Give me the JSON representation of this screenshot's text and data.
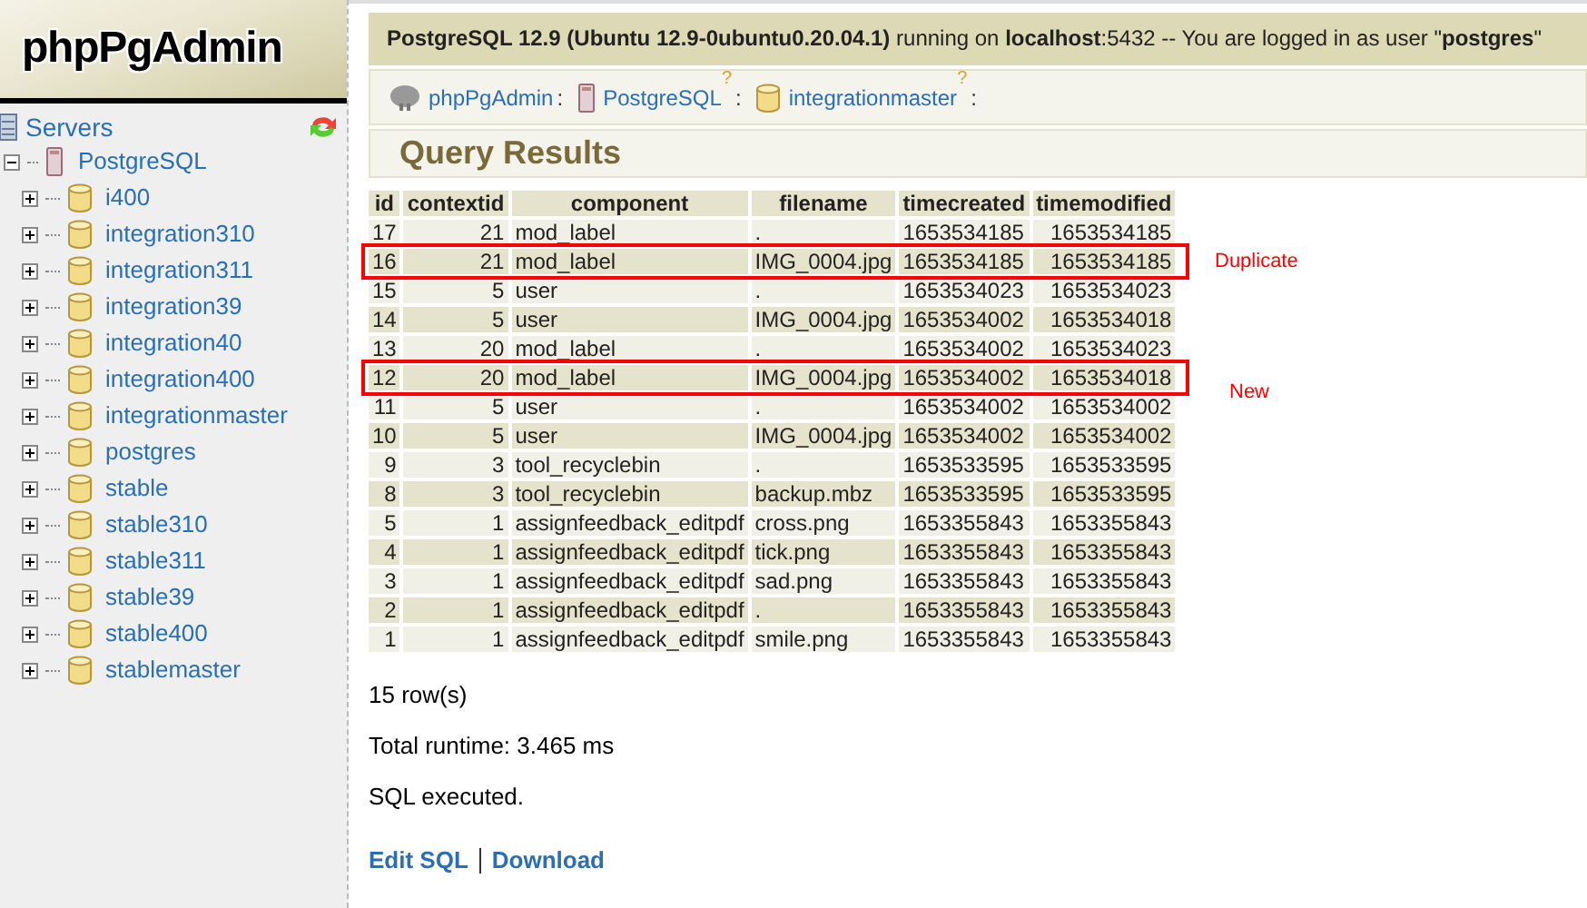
{
  "logo": "phpPgAdmin",
  "sidebar": {
    "root": "Servers",
    "server": {
      "label": "PostgreSQL",
      "expanded": true,
      "children": [
        {
          "label": "i400"
        },
        {
          "label": "integration310"
        },
        {
          "label": "integration311"
        },
        {
          "label": "integration39"
        },
        {
          "label": "integration40"
        },
        {
          "label": "integration400"
        },
        {
          "label": "integrationmaster"
        },
        {
          "label": "postgres"
        },
        {
          "label": "stable"
        },
        {
          "label": "stable310"
        },
        {
          "label": "stable311"
        },
        {
          "label": "stable39"
        },
        {
          "label": "stable400"
        },
        {
          "label": "stablemaster"
        }
      ]
    }
  },
  "server_info": "**PostgreSQL 12.9 (Ubuntu 12.9-0ubuntu0.20.04.1)** running on **localhost**:5432 -- You are logged in as user \"**postgres**\"",
  "breadcrumb": [
    {
      "label": "phpPgAdmin",
      "kind": "app"
    },
    {
      "label": "PostgreSQL",
      "kind": "server",
      "help": "?"
    },
    {
      "label": "integrationmaster",
      "kind": "database",
      "help": "?"
    }
  ],
  "breadcrumb_separator": ":",
  "section_title": "Query Results",
  "table": {
    "columns": [
      "id",
      "contextid",
      "component",
      "filename",
      "timecreated",
      "timemodified"
    ],
    "rows": [
      {
        "cells": [
          "17",
          "21",
          "mod_label",
          ".",
          "1653534185",
          "1653534185"
        ]
      },
      {
        "cells": [
          "16",
          "21",
          "mod_label",
          "IMG_0004.jpg",
          "1653534185",
          "1653534185"
        ],
        "annotation": "Duplicate"
      },
      {
        "cells": [
          "15",
          "5",
          "user",
          ".",
          "1653534023",
          "1653534023"
        ]
      },
      {
        "cells": [
          "14",
          "5",
          "user",
          "IMG_0004.jpg",
          "1653534002",
          "1653534018"
        ]
      },
      {
        "cells": [
          "13",
          "20",
          "mod_label",
          ".",
          "1653534002",
          "1653534023"
        ]
      },
      {
        "cells": [
          "12",
          "20",
          "mod_label",
          "IMG_0004.jpg",
          "1653534002",
          "1653534018"
        ],
        "annotation": "New"
      },
      {
        "cells": [
          "11",
          "5",
          "user",
          ".",
          "1653534002",
          "1653534002"
        ]
      },
      {
        "cells": [
          "10",
          "5",
          "user",
          "IMG_0004.jpg",
          "1653534002",
          "1653534002"
        ]
      },
      {
        "cells": [
          "9",
          "3",
          "tool_recyclebin",
          ".",
          "1653533595",
          "1653533595"
        ]
      },
      {
        "cells": [
          "8",
          "3",
          "tool_recyclebin",
          "backup.mbz",
          "1653533595",
          "1653533595"
        ]
      },
      {
        "cells": [
          "5",
          "1",
          "assignfeedback_editpdf",
          "cross.png",
          "1653355843",
          "1653355843"
        ]
      },
      {
        "cells": [
          "4",
          "1",
          "assignfeedback_editpdf",
          "tick.png",
          "1653355843",
          "1653355843"
        ]
      },
      {
        "cells": [
          "3",
          "1",
          "assignfeedback_editpdf",
          "sad.png",
          "1653355843",
          "1653355843"
        ]
      },
      {
        "cells": [
          "2",
          "1",
          "assignfeedback_editpdf",
          ".",
          "1653355843",
          "1653355843"
        ]
      },
      {
        "cells": [
          "1",
          "1",
          "assignfeedback_editpdf",
          "smile.png",
          "1653355843",
          "1653355843"
        ]
      }
    ]
  },
  "row_count": "15 row(s)",
  "runtime": "Total runtime: 3.465 ms",
  "status": "SQL executed.",
  "actions": [
    "Edit SQL",
    "Download"
  ]
}
